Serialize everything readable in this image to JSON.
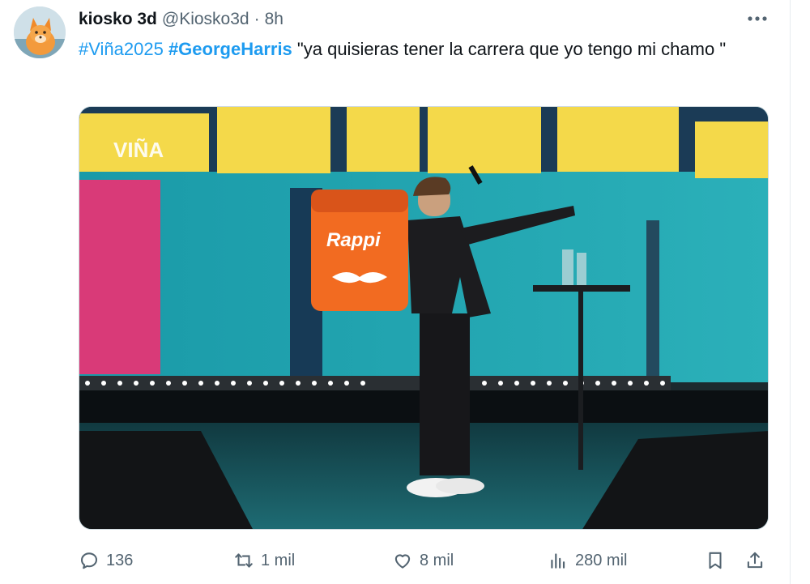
{
  "tweet": {
    "display_name": "kiosko 3d",
    "handle": "@Kiosko3d",
    "separator": "·",
    "time": "8h",
    "hashtags": [
      "#Viña2025",
      "#GeorgeHarris"
    ],
    "body_text": "\"ya quisieras tener la carrera que yo tengo mi chamo \""
  },
  "media": {
    "watermark": "VIÑA",
    "bag_brand": "Rappi"
  },
  "actions": {
    "replies": "136",
    "retweets": "1 mil",
    "likes": "8 mil",
    "views": "280 mil"
  },
  "icons": [
    "avatar-fox",
    "more-icon",
    "reply-icon",
    "retweet-icon",
    "like-icon",
    "views-icon",
    "bookmark-icon",
    "share-icon"
  ],
  "colors": {
    "link": "#1d9bf0",
    "text": "#0f1419",
    "muted": "#536471",
    "rappi_orange": "#f26b21"
  }
}
